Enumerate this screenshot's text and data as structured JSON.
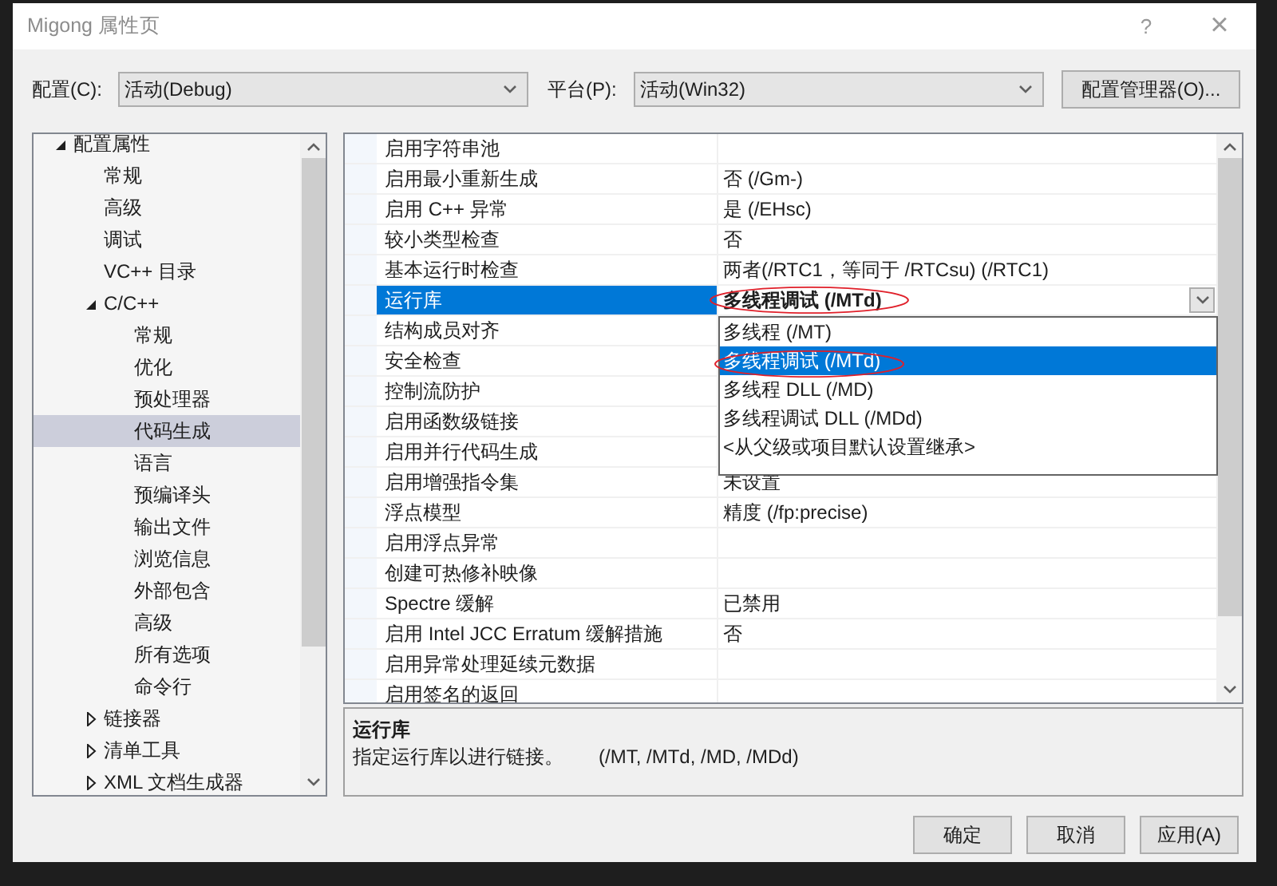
{
  "window": {
    "title": "Migong 属性页",
    "help": "?",
    "close": "×"
  },
  "config": {
    "label": "配置(C):",
    "value": "活动(Debug)"
  },
  "platform": {
    "label": "平台(P):",
    "value": "活动(Win32)"
  },
  "config_manager_button": "配置管理器(O)...",
  "tree": {
    "items": [
      {
        "label": "配置属性",
        "expanded": true,
        "selected": false,
        "children": [
          {
            "label": "常规",
            "selected": false
          },
          {
            "label": "高级",
            "selected": false
          },
          {
            "label": "调试",
            "selected": false
          },
          {
            "label": "VC++ 目录",
            "selected": false
          },
          {
            "label": "C/C++",
            "expanded": true,
            "selected": false,
            "children": [
              {
                "label": "常规",
                "selected": false
              },
              {
                "label": "优化",
                "selected": false
              },
              {
                "label": "预处理器",
                "selected": false
              },
              {
                "label": "代码生成",
                "selected": true
              },
              {
                "label": "语言",
                "selected": false
              },
              {
                "label": "预编译头",
                "selected": false
              },
              {
                "label": "输出文件",
                "selected": false
              },
              {
                "label": "浏览信息",
                "selected": false
              },
              {
                "label": "外部包含",
                "selected": false
              },
              {
                "label": "高级",
                "selected": false
              },
              {
                "label": "所有选项",
                "selected": false
              },
              {
                "label": "命令行",
                "selected": false
              }
            ]
          },
          {
            "label": "链接器",
            "expanded": false,
            "selected": false
          },
          {
            "label": "清单工具",
            "expanded": false,
            "selected": false
          },
          {
            "label": "XML 文档生成器",
            "expanded": false,
            "selected": false
          }
        ]
      }
    ]
  },
  "grid": {
    "rows": [
      {
        "name": "启用字符串池",
        "selected": false
      },
      {
        "name": "启用最小重新生成",
        "value": "否 (/Gm-)",
        "selected": false
      },
      {
        "name": "启用 C++ 异常",
        "value": "是 (/EHsc)",
        "selected": false
      },
      {
        "name": "较小类型检查",
        "value": "否",
        "selected": false
      },
      {
        "name": "基本运行时检查",
        "value": "两者(/RTC1，等同于 /RTCsu) (/RTC1)",
        "selected": false
      },
      {
        "name": "运行库",
        "value": "多线程调试 (/MTd)",
        "selected": true,
        "modified": true,
        "circled": true
      },
      {
        "name": "结构成员对齐",
        "selected": false
      },
      {
        "name": "安全检查",
        "selected": false
      },
      {
        "name": "控制流防护",
        "selected": false
      },
      {
        "name": "启用函数级链接",
        "selected": false
      },
      {
        "name": "启用并行代码生成",
        "selected": false
      },
      {
        "name": "启用增强指令集",
        "value": "未设置",
        "selected": false
      },
      {
        "name": "浮点模型",
        "value": "精度 (/fp:precise)",
        "selected": false
      },
      {
        "name": "启用浮点异常",
        "selected": false
      },
      {
        "name": "创建可热修补映像",
        "selected": false
      },
      {
        "name": "Spectre 缓解",
        "value": "已禁用",
        "selected": false
      },
      {
        "name": "启用 Intel JCC Erratum 缓解措施",
        "value": "否",
        "selected": false
      },
      {
        "name": "启用异常处理延续元数据",
        "selected": false
      },
      {
        "name": "启用签名的返回",
        "selected": false
      }
    ]
  },
  "dropdown": {
    "options": [
      {
        "label": "多线程 (/MT)",
        "selected": false,
        "circled": false
      },
      {
        "label": "多线程调试 (/MTd)",
        "selected": true,
        "circled": true
      },
      {
        "label": "多线程 DLL (/MD)",
        "selected": false,
        "circled": false
      },
      {
        "label": "多线程调试 DLL (/MDd)",
        "selected": false,
        "circled": false
      },
      {
        "label": "<从父级或项目默认设置继承>",
        "selected": false,
        "circled": false
      }
    ]
  },
  "description": {
    "title": "运行库",
    "text": "指定运行库以进行链接。",
    "switches": "(/MT, /MTd, /MD, /MDd)"
  },
  "buttons": [
    "确定",
    "取消",
    "应用(A)"
  ]
}
